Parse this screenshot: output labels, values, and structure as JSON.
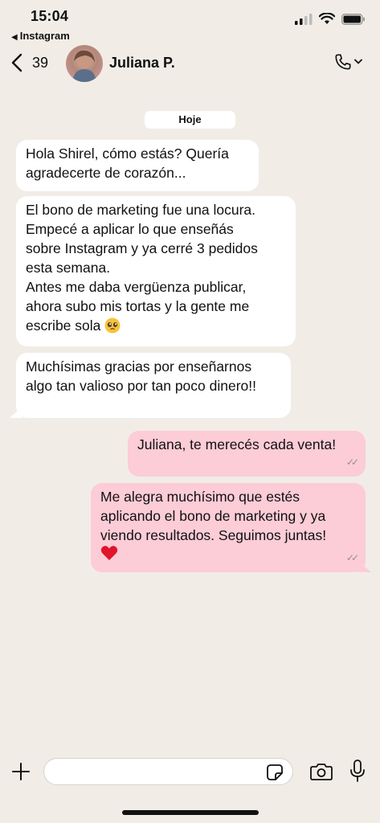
{
  "status_bar": {
    "time": "15:04",
    "back_app": "Instagram"
  },
  "header": {
    "back_count": "39",
    "contact_name": "Juliana P."
  },
  "date_chip": "Hoje",
  "messages": [
    {
      "direction": "incoming",
      "lines": [
        "Hola Shirel, cómo estás? Quería",
        "agradecerte de corazón..."
      ]
    },
    {
      "direction": "incoming",
      "lines": [
        "El bono de marketing fue una locura.",
        "Empecé a aplicar lo que enseñás",
        "sobre Instagram y ya cerré 3 pedidos",
        "esta semana.",
        "Antes me daba vergüenza publicar,",
        "ahora subo mis tortas y la gente me",
        "escribe sola"
      ],
      "emoji": "pleading-face-emoji"
    },
    {
      "direction": "incoming",
      "lines": [
        "Muchísimas gracias por enseñarnos",
        "algo tan valioso por tan poco dinero!!"
      ]
    },
    {
      "direction": "outgoing",
      "lines": [
        "Juliana, te merecés cada venta!"
      ],
      "status": "read"
    },
    {
      "direction": "outgoing",
      "lines": [
        "Me alegra muchísimo que estés",
        "aplicando el bono de marketing y ya",
        "viendo resultados. Seguimos juntas!"
      ],
      "emoji": "red-heart-emoji",
      "status": "read"
    }
  ],
  "composer": {
    "placeholder": ""
  },
  "colors": {
    "background": "#f1ede6",
    "incoming_bubble": "#ffffff",
    "outgoing_bubble": "#fcccd7",
    "text": "#111111"
  },
  "icons": [
    "back-triangle-icon",
    "cellular-signal-icon",
    "wifi-icon",
    "battery-icon",
    "chevron-left-icon",
    "phone-icon",
    "chevron-down-icon",
    "plus-icon",
    "sticker-icon",
    "camera-icon",
    "microphone-icon"
  ]
}
